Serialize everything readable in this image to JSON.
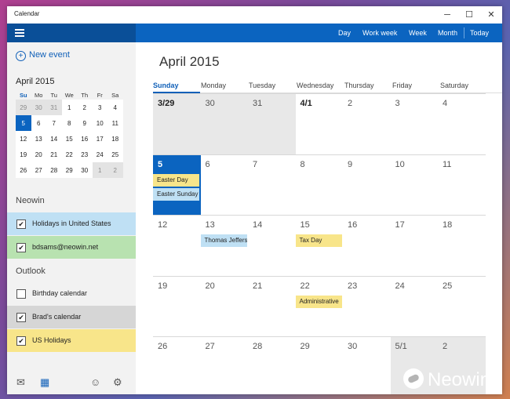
{
  "window": {
    "title": "Calendar",
    "controls": [
      "─",
      "☐",
      "✕"
    ]
  },
  "toolbar": {
    "views": [
      "Day",
      "Work week",
      "Week",
      "Month",
      "Today"
    ]
  },
  "sidebar": {
    "new_event": "New event",
    "mini_month": "April 2015",
    "weekday_abbr": [
      "Su",
      "Mo",
      "Tu",
      "We",
      "Th",
      "Fr",
      "Sa"
    ],
    "weeks": [
      [
        "29",
        "30",
        "31",
        "1",
        "2",
        "3",
        "4"
      ],
      [
        "5",
        "6",
        "7",
        "8",
        "9",
        "10",
        "11"
      ],
      [
        "12",
        "13",
        "14",
        "15",
        "16",
        "17",
        "18"
      ],
      [
        "19",
        "20",
        "21",
        "22",
        "23",
        "24",
        "25"
      ],
      [
        "26",
        "27",
        "28",
        "29",
        "30",
        "1",
        "2"
      ]
    ],
    "groups": [
      {
        "name": "Neowin",
        "calendars": [
          {
            "label": "Holidays in United States",
            "checked": true,
            "color": "#bfe0f4"
          },
          {
            "label": "bdsams@neowin.net",
            "checked": true,
            "color": "#b8e2b0"
          }
        ]
      },
      {
        "name": "Outlook",
        "calendars": [
          {
            "label": "Birthday calendar",
            "checked": false,
            "color": "#f2f2f2"
          },
          {
            "label": "Brad's calendar",
            "checked": true,
            "color": "#d6d6d6"
          },
          {
            "label": "US Holidays",
            "checked": true,
            "color": "#f8e58a"
          }
        ]
      }
    ],
    "bottom_icons": [
      "mail-icon",
      "calendar-icon",
      "feedback-icon",
      "settings-icon"
    ]
  },
  "main": {
    "month_title": "April 2015",
    "weekdays": [
      "Sunday",
      "Monday",
      "Tuesday",
      "Wednesday",
      "Thursday",
      "Friday",
      "Saturday"
    ],
    "weeks": [
      [
        "3/29",
        "30",
        "31",
        "4/1",
        "2",
        "3",
        "4"
      ],
      [
        "5",
        "6",
        "7",
        "8",
        "9",
        "10",
        "11"
      ],
      [
        "12",
        "13",
        "14",
        "15",
        "16",
        "17",
        "18"
      ],
      [
        "19",
        "20",
        "21",
        "22",
        "23",
        "24",
        "25"
      ],
      [
        "26",
        "27",
        "28",
        "29",
        "30",
        "5/1",
        "2"
      ]
    ],
    "events": [
      {
        "week": 1,
        "day": 0,
        "slot": 0,
        "title": "Easter Day",
        "color": "yellow"
      },
      {
        "week": 1,
        "day": 0,
        "slot": 1,
        "title": "Easter Sunday",
        "color": "blue"
      },
      {
        "week": 2,
        "day": 1,
        "slot": 0,
        "title": "Thomas Jefferson",
        "color": "blue"
      },
      {
        "week": 2,
        "day": 3,
        "slot": 0,
        "title": "Tax Day",
        "color": "yellow"
      },
      {
        "week": 3,
        "day": 3,
        "slot": 0,
        "title": "Administrative",
        "color": "yellow"
      }
    ]
  },
  "watermark": "Neowin",
  "colors": {
    "accent": "#0b64c0",
    "accent_dark": "#0a4f98"
  }
}
